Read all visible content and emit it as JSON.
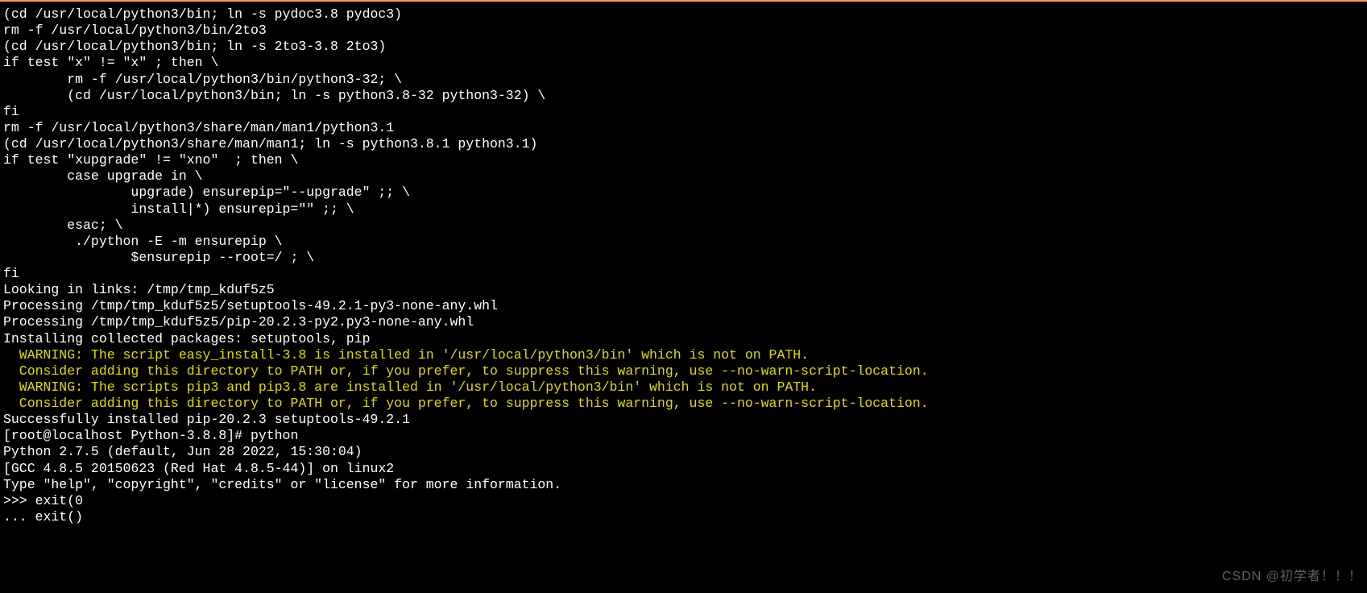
{
  "terminal": {
    "lines": [
      {
        "text": "(cd /usr/local/python3/bin; ln -s pydoc3.8 pydoc3)",
        "class": ""
      },
      {
        "text": "rm -f /usr/local/python3/bin/2to3",
        "class": ""
      },
      {
        "text": "(cd /usr/local/python3/bin; ln -s 2to3-3.8 2to3)",
        "class": ""
      },
      {
        "text": "if test \"x\" != \"x\" ; then \\",
        "class": ""
      },
      {
        "text": "        rm -f /usr/local/python3/bin/python3-32; \\",
        "class": ""
      },
      {
        "text": "        (cd /usr/local/python3/bin; ln -s python3.8-32 python3-32) \\",
        "class": ""
      },
      {
        "text": "fi",
        "class": ""
      },
      {
        "text": "rm -f /usr/local/python3/share/man/man1/python3.1",
        "class": ""
      },
      {
        "text": "(cd /usr/local/python3/share/man/man1; ln -s python3.8.1 python3.1)",
        "class": ""
      },
      {
        "text": "if test \"xupgrade\" != \"xno\"  ; then \\",
        "class": ""
      },
      {
        "text": "        case upgrade in \\",
        "class": ""
      },
      {
        "text": "                upgrade) ensurepip=\"--upgrade\" ;; \\",
        "class": ""
      },
      {
        "text": "                install|*) ensurepip=\"\" ;; \\",
        "class": ""
      },
      {
        "text": "        esac; \\",
        "class": ""
      },
      {
        "text": "         ./python -E -m ensurepip \\",
        "class": ""
      },
      {
        "text": "                $ensurepip --root=/ ; \\",
        "class": ""
      },
      {
        "text": "fi",
        "class": ""
      },
      {
        "text": "Looking in links: /tmp/tmp_kduf5z5",
        "class": ""
      },
      {
        "text": "Processing /tmp/tmp_kduf5z5/setuptools-49.2.1-py3-none-any.whl",
        "class": ""
      },
      {
        "text": "Processing /tmp/tmp_kduf5z5/pip-20.2.3-py2.py3-none-any.whl",
        "class": ""
      },
      {
        "text": "Installing collected packages: setuptools, pip",
        "class": ""
      },
      {
        "text": "  WARNING: The script easy_install-3.8 is installed in '/usr/local/python3/bin' which is not on PATH.",
        "class": "yellow"
      },
      {
        "text": "  Consider adding this directory to PATH or, if you prefer, to suppress this warning, use --no-warn-script-location.",
        "class": "yellow"
      },
      {
        "text": "  WARNING: The scripts pip3 and pip3.8 are installed in '/usr/local/python3/bin' which is not on PATH.",
        "class": "yellow"
      },
      {
        "text": "  Consider adding this directory to PATH or, if you prefer, to suppress this warning, use --no-warn-script-location.",
        "class": "yellow"
      },
      {
        "text": "Successfully installed pip-20.2.3 setuptools-49.2.1",
        "class": ""
      },
      {
        "text": "[root@localhost Python-3.8.8]# python",
        "class": ""
      },
      {
        "text": "Python 2.7.5 (default, Jun 28 2022, 15:30:04) ",
        "class": ""
      },
      {
        "text": "[GCC 4.8.5 20150623 (Red Hat 4.8.5-44)] on linux2",
        "class": ""
      },
      {
        "text": "Type \"help\", \"copyright\", \"credits\" or \"license\" for more information.",
        "class": ""
      },
      {
        "text": ">>> exit(0",
        "class": ""
      },
      {
        "text": "... exit()",
        "class": ""
      }
    ]
  },
  "watermark": {
    "text": "CSDN @初学者！！！"
  }
}
